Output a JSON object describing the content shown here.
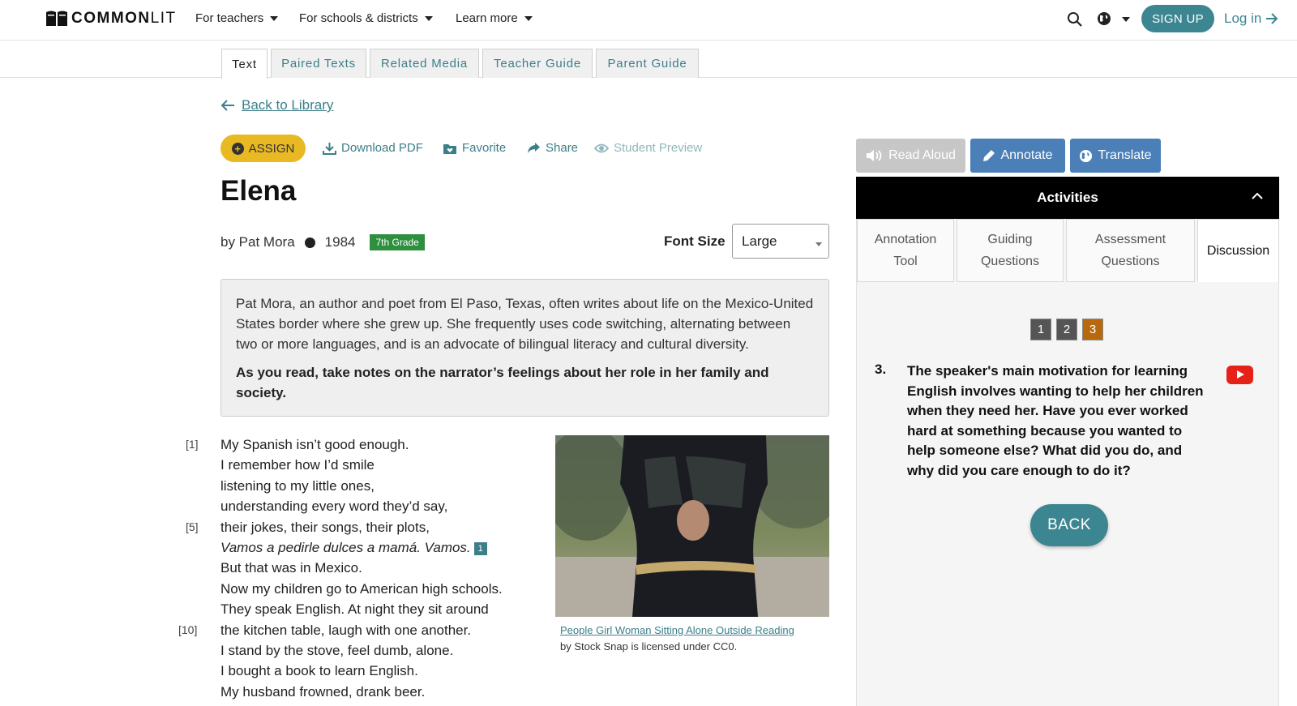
{
  "brand": {
    "logo_bold": "COMMON",
    "logo_light": "LIT"
  },
  "nav": {
    "items": [
      "For teachers",
      "For schools & districts",
      "Learn more"
    ],
    "signup": "SIGN UP",
    "login": "Log in"
  },
  "tabs": [
    "Text",
    "Paired Texts",
    "Related Media",
    "Teacher Guide",
    "Parent Guide"
  ],
  "back_link": "Back to Library",
  "actions": {
    "assign": "ASSIGN",
    "download": "Download PDF",
    "favorite": "Favorite",
    "share": "Share",
    "preview": "Student Preview"
  },
  "text": {
    "title": "Elena",
    "author": "by Pat Mora",
    "year": "1984",
    "grade": "7th Grade",
    "font_size_label": "Font Size",
    "font_size_value": "Large",
    "intro": "Pat Mora, an author and poet from El Paso, Texas, often writes about life on the Mexico-United States border where she grew up. She frequently uses code switching, alternating between two or more languages, and is an advocate of bilingual literacy and cultural diversity.",
    "prompt": "As you read, take notes on the narrator’s feelings about her role in her family and society.",
    "line_numbers": [
      "[1]",
      "[5]",
      "[10]"
    ],
    "poem_lines": [
      "My Spanish isn’t good enough.",
      "I remember how I’d smile",
      "listening to my little ones,",
      "understanding every word they’d say,",
      "their jokes, their songs, their plots,",
      "Vamos a pedirle dulces a mamá. Vamos.",
      "But that was in Mexico.",
      "Now my children go to American high schools.",
      "They speak English. At night they sit around",
      "the kitchen table, laugh with one another.",
      "I stand by the stove, feel dumb, alone.",
      "I bought a book to learn English.",
      "My husband frowned, drank beer."
    ],
    "footnote": "1",
    "image_caption_link": "People Girl Woman Sitting Alone Outside Reading",
    "image_caption_credit": "by Stock Snap is licensed under CC0."
  },
  "tools": {
    "read_aloud": "Read Aloud",
    "annotate": "Annotate",
    "translate": "Translate"
  },
  "activities": {
    "title": "Activities",
    "tabs": [
      {
        "line1": "Annotation",
        "line2": "Tool"
      },
      {
        "line1": "Guiding",
        "line2": "Questions"
      },
      {
        "line1": "Assessment",
        "line2": "Questions"
      },
      {
        "line1": "Discussion",
        "line2": ""
      }
    ],
    "pages": [
      "1",
      "2",
      "3"
    ],
    "question_number": "3.",
    "question": "The speaker's main motivation for learning English involves wanting to help her children when they need her. Have you ever worked hard at something because you wanted to help someone else? What did you do, and why did you care enough to do it?",
    "back": "BACK"
  },
  "colors": {
    "teal": "#3b8691",
    "assign_yellow": "#e8b923",
    "grade_green": "#2e8f3e",
    "page_current": "#b8690e",
    "tool_blue": "#4a7fb8"
  }
}
